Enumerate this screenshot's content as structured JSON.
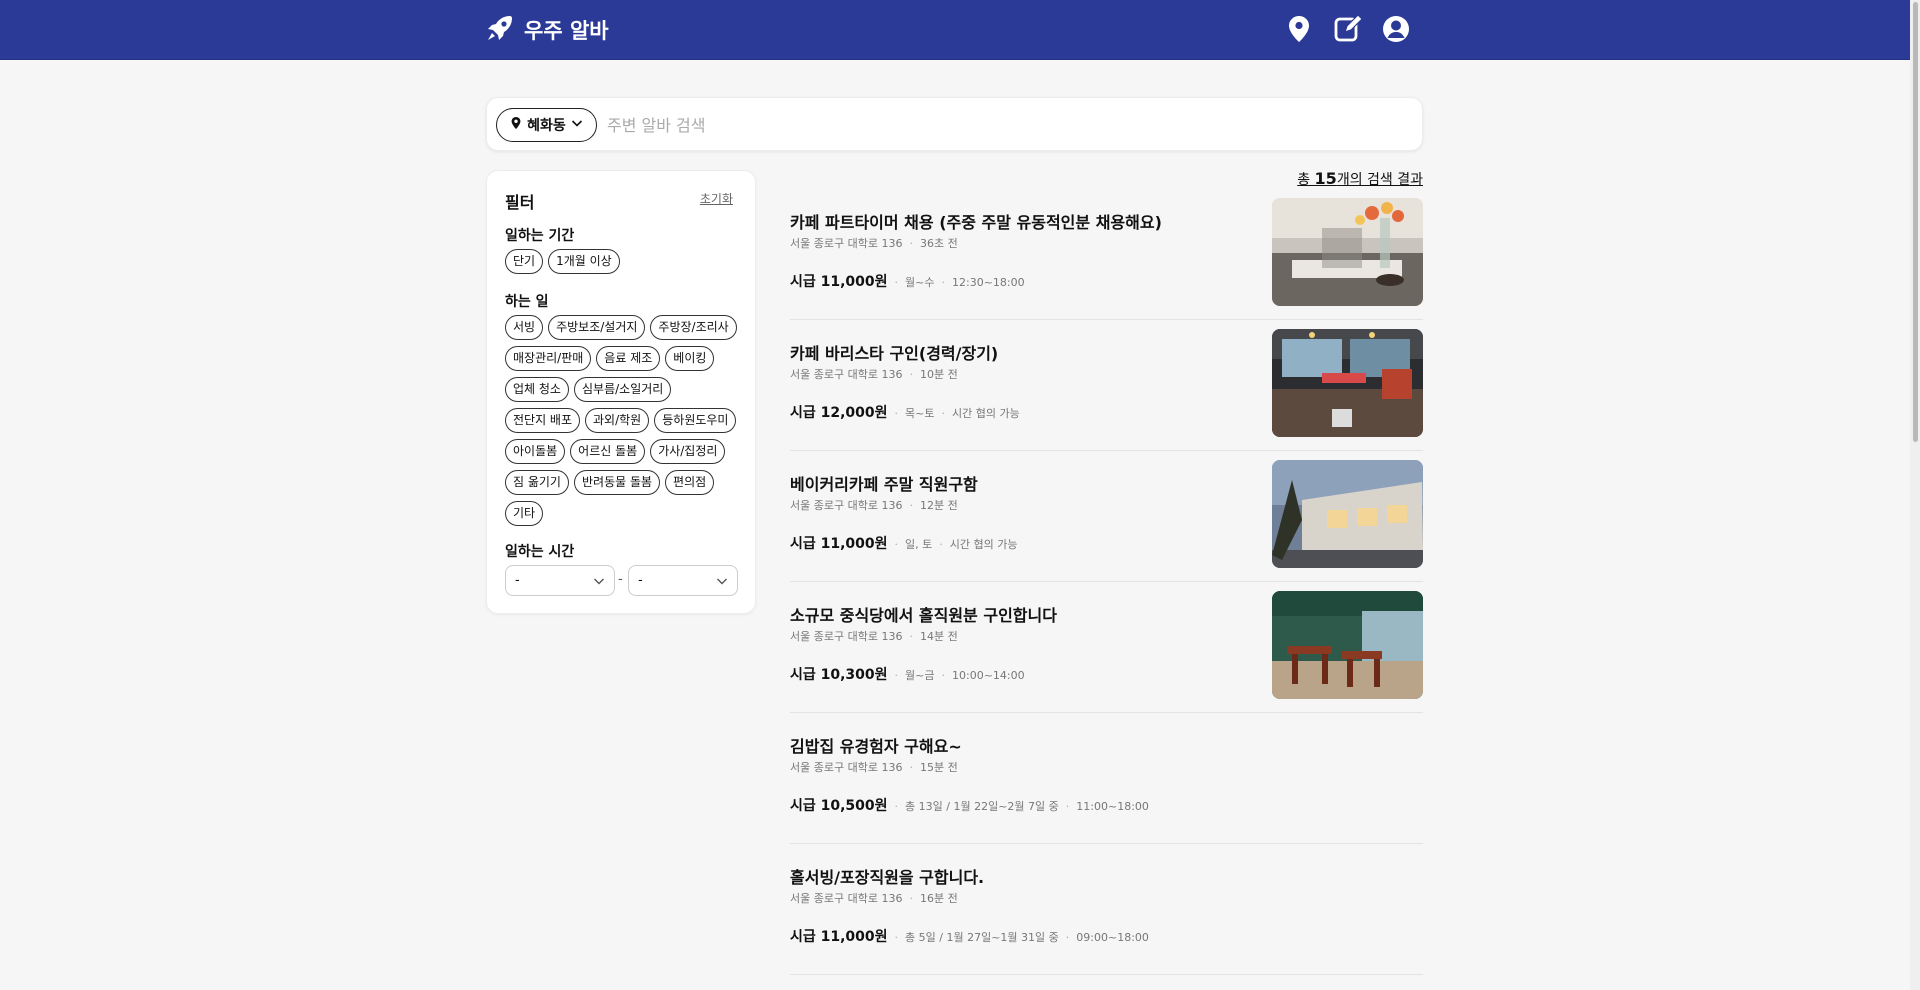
{
  "header": {
    "app_name": "우주 알바",
    "icons": [
      "rocket-icon",
      "map-pin-icon",
      "edit-icon",
      "user-circle-icon"
    ],
    "bg_color": "#2b3a96"
  },
  "search": {
    "location": "혜화동",
    "placeholder": "주변 알바 검색"
  },
  "filter": {
    "title": "필터",
    "reset": "초기화",
    "period": {
      "label": "일하는 기간",
      "chips": [
        "단기",
        "1개월 이상"
      ]
    },
    "work": {
      "label": "하는 일",
      "chips": [
        "서빙",
        "주방보조/설거지",
        "주방장/조리사",
        "매장관리/판매",
        "음료 제조",
        "베이킹",
        "업체 청소",
        "심부름/소일거리",
        "전단지 배포",
        "과외/학원",
        "등하원도우미",
        "아이돌봄",
        "어르신 돌봄",
        "가사/집정리",
        "짐 옮기기",
        "반려동물 돌봄",
        "편의점",
        "기타"
      ]
    },
    "time": {
      "label": "일하는 시간",
      "start": "-",
      "dash": "-",
      "end": "-"
    }
  },
  "results": {
    "prefix": "총 ",
    "count": "15",
    "suffix": "개의 검색 결과",
    "jobs": [
      {
        "title": "카페 파트타이머 채용 (주중 주말 유동적인분 채용해요)",
        "address": "서울 종로구 대학로 136",
        "time_ago": "36초 전",
        "wage": "시급 11,000원",
        "days": "월~수",
        "hours": "12:30~18:00"
      },
      {
        "title": "카페 바리스타 구인(경력/장기)",
        "address": "서울 종로구 대학로 136",
        "time_ago": "10분 전",
        "wage": "시급 12,000원",
        "days": "목~토",
        "hours": "시간 협의 가능"
      },
      {
        "title": "베이커리카페 주말 직원구함",
        "address": "서울 종로구 대학로 136",
        "time_ago": "12분 전",
        "wage": "시급 11,000원",
        "days": "일, 토",
        "hours": "시간 협의 가능"
      },
      {
        "title": "소규모 중식당에서 홀직원분 구인합니다",
        "address": "서울 종로구 대학로 136",
        "time_ago": "14분 전",
        "wage": "시급 10,300원",
        "days": "월~금",
        "hours": "10:00~14:00"
      },
      {
        "title": "김밥집 유경험자 구해요~",
        "address": "서울 종로구 대학로 136",
        "time_ago": "15분 전",
        "wage": "시급 10,500원",
        "days": "총 13일 / 1월 22일~2월 7일 중",
        "hours": "11:00~18:00"
      },
      {
        "title": "홀서빙/포장직원을 구합니다.",
        "address": "서울 종로구 대학로 136",
        "time_ago": "16분 전",
        "wage": "시급 11,000원",
        "days": "총 5일 / 1월 27일~1월 31일 중",
        "hours": "09:00~18:00"
      }
    ]
  }
}
